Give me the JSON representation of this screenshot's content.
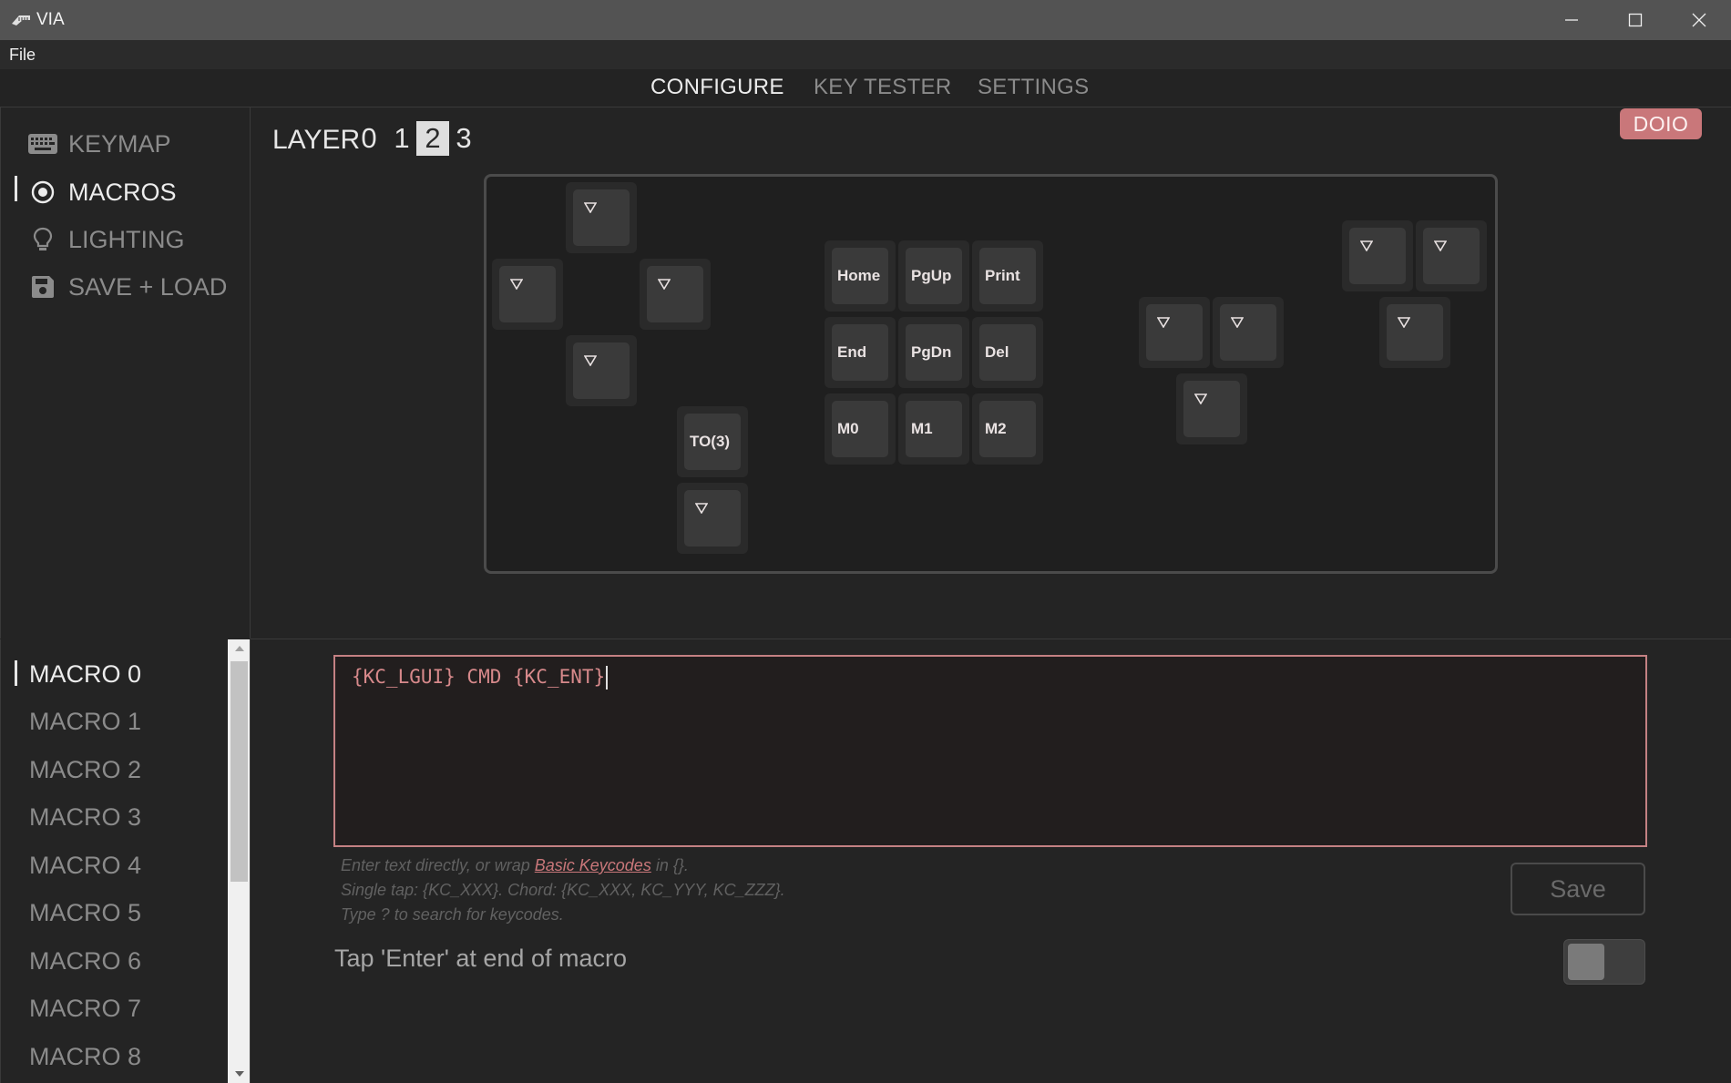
{
  "window": {
    "title": "VIA",
    "controls": {
      "minimize": "minimize-icon",
      "maximize": "maximize-icon",
      "close": "close-icon"
    }
  },
  "menubar": {
    "file": "File"
  },
  "topnav": {
    "tabs": [
      {
        "label": "CONFIGURE",
        "active": true
      },
      {
        "label": "KEY TESTER",
        "active": false
      },
      {
        "label": "SETTINGS",
        "active": false
      }
    ]
  },
  "leftmenu": {
    "items": [
      {
        "label": "KEYMAP",
        "icon": "keyboard-icon",
        "active": false
      },
      {
        "label": "MACROS",
        "icon": "macro-icon",
        "active": true
      },
      {
        "label": "LIGHTING",
        "icon": "lightbulb-icon",
        "active": false
      },
      {
        "label": "SAVE + LOAD",
        "icon": "save-icon",
        "active": false
      }
    ]
  },
  "layers": {
    "label": "LAYER",
    "options": [
      "0",
      "1",
      "2",
      "3"
    ],
    "selected": "2"
  },
  "badge": {
    "text": "DOIO",
    "color": "#c9777a"
  },
  "keys": {
    "home": "Home",
    "pgup": "PgUp",
    "print": "Print",
    "end": "End",
    "pgdn": "PgDn",
    "del": "Del",
    "m0": "M0",
    "m1": "M1",
    "m2": "M2",
    "to3": "TO(3)",
    "transparent_icon": "down-triangle-icon"
  },
  "macros": {
    "items": [
      "MACRO 0",
      "MACRO 1",
      "MACRO 2",
      "MACRO 3",
      "MACRO 4",
      "MACRO 5",
      "MACRO 6",
      "MACRO 7",
      "MACRO 8"
    ],
    "selected": "MACRO 0"
  },
  "editor": {
    "value": "{KC_LGUI} CMD {KC_ENT}",
    "help_line1_prefix": "Enter text directly, or wrap ",
    "help_link": "Basic Keycodes",
    "help_line1_suffix": " in {}.",
    "help_line2": "Single tap: {KC_XXX}. Chord: {KC_XXX, KC_YYY, KC_ZZZ}.",
    "help_line3": "Type ? to search for keycodes.",
    "save_label": "Save",
    "enter_toggle_label": "Tap 'Enter' at end of macro",
    "enter_toggle_on": false
  },
  "colors": {
    "accent": "#c9777a",
    "background": "#242424"
  }
}
